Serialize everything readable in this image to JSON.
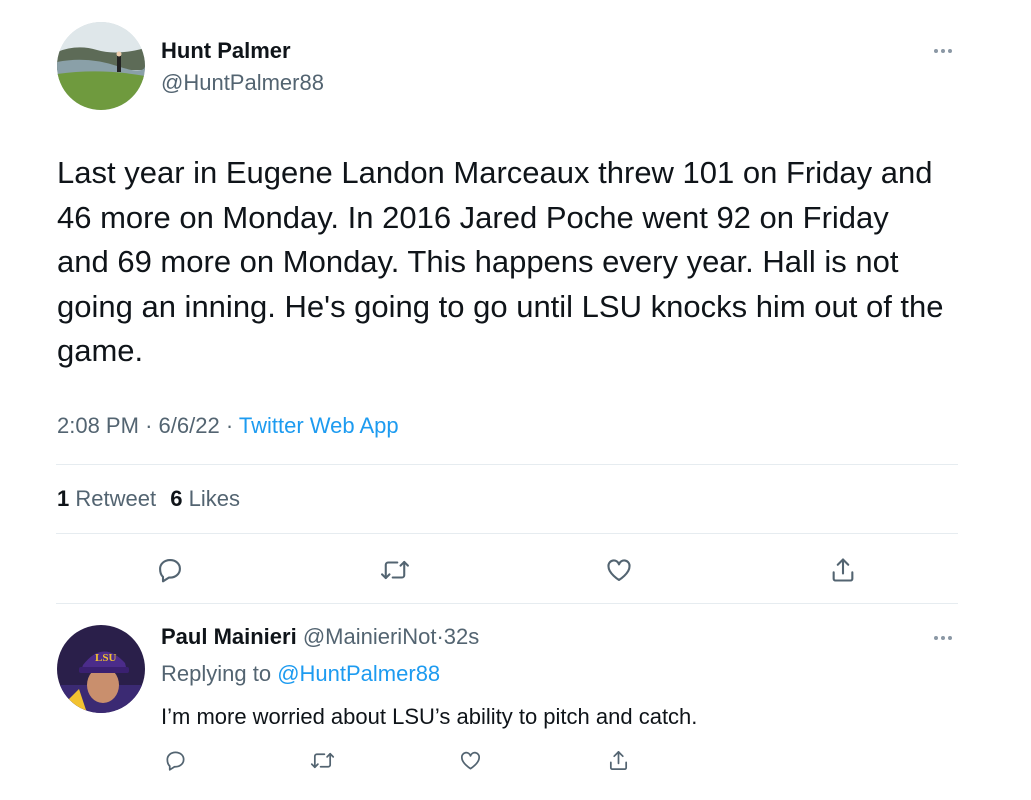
{
  "main_tweet": {
    "author": {
      "display_name": "Hunt Palmer",
      "handle": "@HuntPalmer88",
      "avatar_icon": "golfer-on-cliff-avatar"
    },
    "text": "Last year in Eugene Landon Marceaux threw 101 on Friday and 46 more on Monday. In 2016 Jared Poche went 92 on Friday and 69 more on Monday. This happens every year. Hall is not going an inning. He's going to go until LSU knocks him out of the game.",
    "time": "2:08 PM",
    "separator": "·",
    "date": "6/6/22",
    "source": "Twitter Web App",
    "stats": {
      "retweets_count": "1",
      "retweets_label": "Retweet",
      "likes_count": "6",
      "likes_label": "Likes"
    },
    "actions": [
      "reply-icon",
      "retweet-icon",
      "like-icon",
      "share-icon"
    ]
  },
  "reply": {
    "author": {
      "display_name": "Paul Mainieri",
      "handle": "@MainieriNot",
      "separator": "·",
      "time_ago": "32s",
      "avatar_icon": "lsu-cap-avatar"
    },
    "replying_label": "Replying to",
    "replying_to": "@HuntPalmer88",
    "text": "I’m more worried about LSU’s ability to pitch and catch.",
    "actions": [
      "reply-icon",
      "retweet-icon",
      "like-icon",
      "share-icon"
    ]
  },
  "colors": {
    "text": "#0f1419",
    "muted": "#536471",
    "link": "#1d9bf0",
    "divider": "#e6ecf0"
  }
}
